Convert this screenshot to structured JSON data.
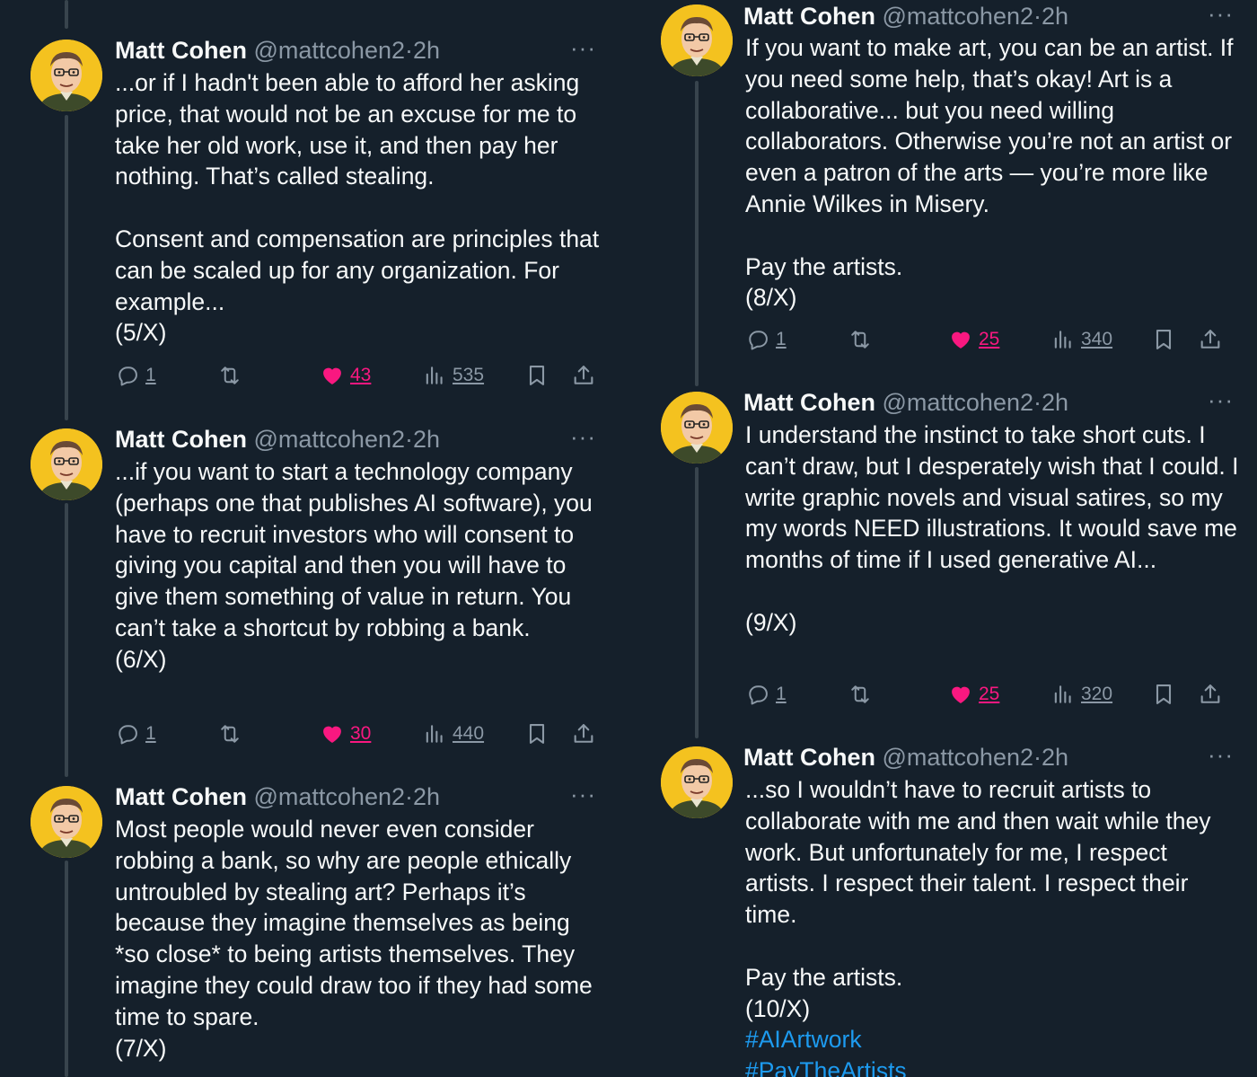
{
  "author": {
    "name": "Matt Cohen",
    "handle": "@mattcohen2",
    "dot": "·",
    "time": "2h",
    "more": "···"
  },
  "colors": {
    "background": "#15202b",
    "text": "#f7f9f9",
    "secondary": "#8b98a5",
    "like": "#f91880",
    "link": "#1d9bf0",
    "avatar_bg": "#f4c21f",
    "thread_line": "#38444d"
  },
  "icons": {
    "reply": "reply-icon",
    "retweet": "retweet-icon",
    "like": "heart-icon",
    "views": "views-icon",
    "bookmark": "bookmark-icon",
    "share": "share-icon",
    "more": "more-icon"
  },
  "tweets": [
    {
      "text": "...or if I hadn't been able to afford her asking price, that would not be an excuse for me to take her old work, use it, and then pay her nothing. That’s called stealing.\n\nConsent and compensation are principles that can be scaled up for any organization. For example...\n(5/X)",
      "replies": "1",
      "likes": "43",
      "views": "535"
    },
    {
      "text": "...if you want to start a technology company (perhaps one that publishes AI software), you have to recruit investors who will consent to giving you capital and then you will have to give them something of value in return. You can’t take a shortcut by robbing a bank.\n(6/X)",
      "replies": "1",
      "likes": "30",
      "views": "440"
    },
    {
      "text": "Most people would never even consider robbing a bank, so why are people ethically untroubled by stealing art? Perhaps it’s because they imagine themselves as being *so close* to being artists themselves. They imagine they could draw too if they had some time to spare.\n(7/X)"
    },
    {
      "text": "If you want to make art, you can be an artist. If you need some help, that’s okay! Art is a collaborative... but you need willing collaborators. Otherwise you’re not an artist or even a patron of the arts — you’re more like Annie Wilkes in Misery.\n\nPay the artists.\n(8/X)",
      "replies": "1",
      "likes": "25",
      "views": "340"
    },
    {
      "text": "I understand the instinct to take short cuts. I can’t draw, but I desperately wish that I could. I write graphic novels and visual satires, so my my words NEED illustrations. It would save me months of time if I used generative AI...\n\n(9/X)",
      "replies": "1",
      "likes": "25",
      "views": "320"
    },
    {
      "text": "...so I wouldn’t have to recruit artists to collaborate with me and then wait while they work. But unfortunately for me, I respect artists. I respect their talent. I respect their time.\n\nPay the artists.\n(10/X)",
      "hashtags": [
        "#AIArtwork",
        "#PayTheArtists"
      ]
    }
  ]
}
